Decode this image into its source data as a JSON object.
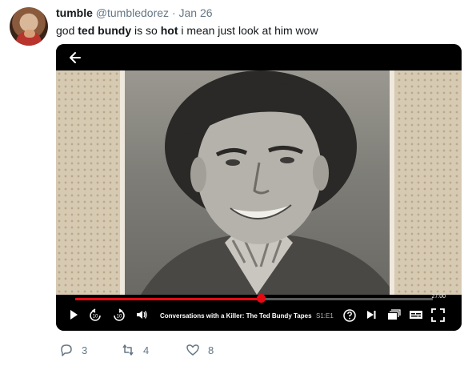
{
  "tweet": {
    "name": "tumble",
    "handle": "@tumbledorez",
    "separator": "·",
    "date": "Jan 26",
    "text": {
      "part1": "god ",
      "bold1": "ted bundy",
      "part2": " is so ",
      "bold2": "hot",
      "part3": " i mean just look at him wow"
    }
  },
  "player": {
    "time_remaining": "27:00",
    "progress_fraction": 0.52,
    "title": "Conversations with a Killer: The Ted Bundy Tapes",
    "episode": "S1:E1",
    "accent_color": "#e50914",
    "icons": [
      "back-arrow-icon",
      "play-icon",
      "rewind-10-icon",
      "forward-10-icon",
      "volume-icon",
      "help-icon",
      "next-episode-icon",
      "episodes-icon",
      "subtitles-icon",
      "fullscreen-icon"
    ]
  },
  "actions": {
    "replies": "3",
    "retweets": "4",
    "likes": "8"
  }
}
